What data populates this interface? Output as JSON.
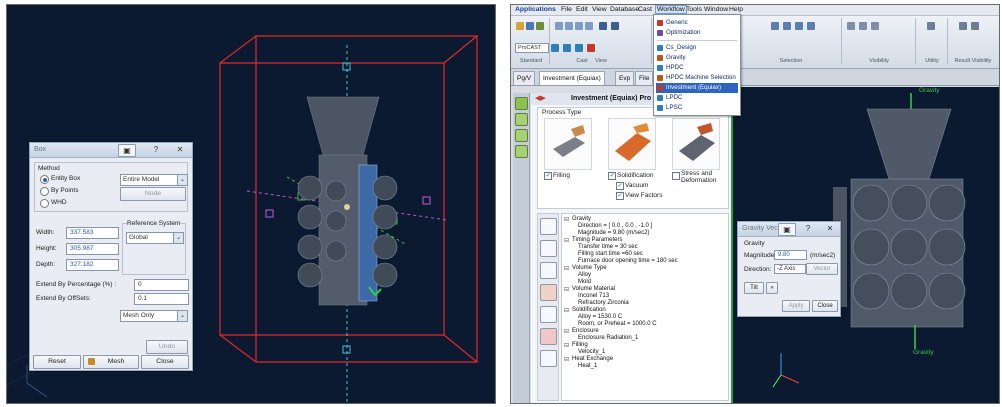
{
  "left": {
    "box_dialog": {
      "title": "Box",
      "question": "?",
      "close": "✕",
      "method_label": "Method",
      "methods": [
        "Entity Box",
        "By Points",
        "WHD"
      ],
      "entity_select": "Entire Model",
      "node_button": "Node",
      "reference_system_label": "Reference System",
      "reference_system_value": "Global",
      "width_label": "Width:",
      "width_value": "337.583",
      "height_label": "Height:",
      "height_value": "305.987",
      "depth_label": "Depth:",
      "depth_value": "327.182",
      "extend_pct_label": "Extend By Percentage (%) :",
      "extend_pct_value": "0",
      "extend_off_label": "Extend By OffSets:",
      "extend_off_value": "0.1",
      "mesh_mode": "Mesh Only",
      "undo_label": "Undo",
      "reset_label": "Reset",
      "mesh_label": "Mesh",
      "close_label": "Close"
    }
  },
  "right": {
    "menu": [
      "Applications",
      "File",
      "Edit",
      "View",
      "Database",
      "Cast",
      "Workflow",
      "Tools",
      "Window",
      "Help"
    ],
    "ribbon_groups": [
      "Standard",
      "View",
      "Cast",
      "Selection",
      "Visibility",
      "Utility",
      "Result Visibility"
    ],
    "ribbon_combo": "ProCAST",
    "tabs": [
      "Pg/V",
      "Investment (Equiax)",
      "Evp",
      "File"
    ],
    "workflow_menu": [
      {
        "label": "Generic",
        "color": "#c0392b"
      },
      {
        "label": "Optimization",
        "color": "#6d4aa3"
      },
      {
        "label": "Cs_Design",
        "color": "#2c7fb8"
      },
      {
        "label": "Gravity",
        "color": "#b35a12"
      },
      {
        "label": "HPDC",
        "color": "#2c7fb8"
      },
      {
        "label": "HPDC Machine Selection",
        "color": "#b35a12"
      },
      {
        "label": "Investment (Equiax)",
        "color": "#c0392b"
      },
      {
        "label": "LPDC",
        "color": "#2c7fb8"
      },
      {
        "label": "LPSC",
        "color": "#2c7fb8"
      }
    ],
    "panel_title": "Investment (Equiax) Pro",
    "process_type_label": "Process Type",
    "process_types": [
      {
        "label": "Filling",
        "checked": true
      },
      {
        "label": "Solidification",
        "checked": true
      },
      {
        "label": "Stress and Deformation",
        "checked": false
      }
    ],
    "solid_options": [
      {
        "label": "Vacuum",
        "checked": true
      },
      {
        "label": "View Factors",
        "checked": true
      }
    ],
    "tree": [
      {
        "text": "Gravity",
        "head": true
      },
      {
        "text": "Direction = [ 0.0 , 0.0 , -1.0 ]",
        "head": false
      },
      {
        "text": "Magnitude = 9.80 (m/sec2)",
        "head": false
      },
      {
        "text": "Timing Parameters",
        "head": true
      },
      {
        "text": "Transfer time = 30 sec",
        "head": false
      },
      {
        "text": "Filling start time =60 sec",
        "head": false
      },
      {
        "text": "Furnace door opening time = 180 sec",
        "head": false
      },
      {
        "text": "Volume Type",
        "head": true
      },
      {
        "text": "Alloy",
        "head": false
      },
      {
        "text": "Mold",
        "head": false
      },
      {
        "text": "Volume Material",
        "head": true
      },
      {
        "text": "Inconel 713",
        "head": false
      },
      {
        "text": "Refractory Zirconia",
        "head": false
      },
      {
        "text": "Solidification",
        "head": true
      },
      {
        "text": "Alloy = 1530.0 C",
        "head": false
      },
      {
        "text": "Room, or Preheat = 1000.0 C",
        "head": false
      },
      {
        "text": "Enclosure",
        "head": true
      },
      {
        "text": "Enclosure Radiation_1",
        "head": false
      },
      {
        "text": "Filling",
        "head": true
      },
      {
        "text": "Velocity_1",
        "head": false
      },
      {
        "text": "Heat Exchange",
        "head": true
      },
      {
        "text": "Heat_1",
        "head": false
      }
    ],
    "gravity_label_top": "Gravity",
    "gravity_label_bottom": "Gravity",
    "gravity_dialog": {
      "title": "Gravity Vect",
      "question": "?",
      "close": "✕",
      "group_label": "Gravity",
      "magnitude_label": "Magnitude:",
      "magnitude_value": "9.80",
      "magnitude_unit": "(m/sec2)",
      "direction_label": "Direction:",
      "direction_value": "-Z Axis",
      "vector_label": "Vector",
      "tilt_label": "Tilt",
      "apply_label": "Apply",
      "close_label": "Close"
    }
  }
}
